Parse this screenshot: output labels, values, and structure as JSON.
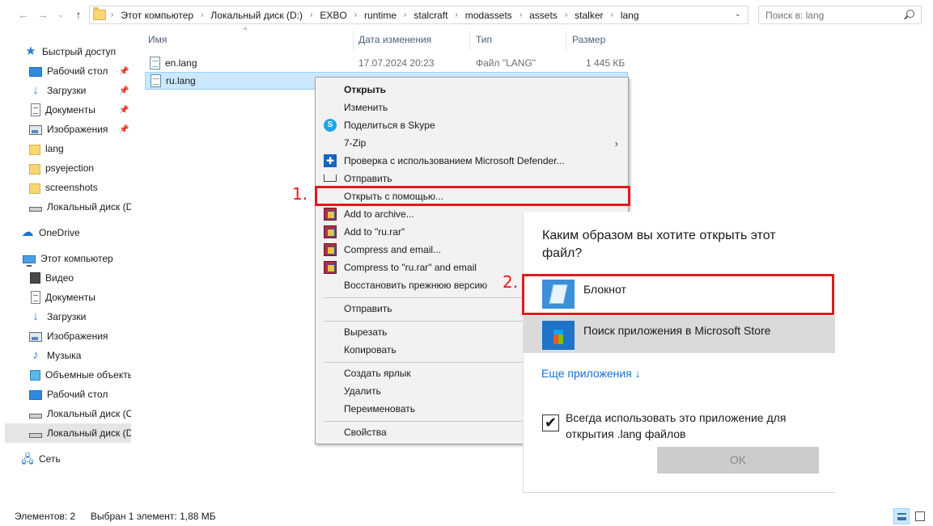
{
  "address": {
    "crumbs": [
      "Этот компьютер",
      "Локальный диск (D:)",
      "EXBO",
      "runtime",
      "stalcraft",
      "modassets",
      "assets",
      "stalker",
      "lang"
    ],
    "search_placeholder": "Поиск в: lang"
  },
  "sidebar": {
    "items": [
      {
        "label": "Быстрый доступ",
        "icon": "star-icon"
      },
      {
        "label": "Рабочий стол",
        "icon": "desktop-icon",
        "pinned": true
      },
      {
        "label": "Загрузки",
        "icon": "downloads-icon",
        "pinned": true
      },
      {
        "label": "Документы",
        "icon": "documents-icon",
        "pinned": true
      },
      {
        "label": "Изображения",
        "icon": "pictures-icon",
        "pinned": true
      },
      {
        "label": "lang",
        "icon": "folder-icon"
      },
      {
        "label": "psyejection",
        "icon": "folder-icon"
      },
      {
        "label": "screenshots",
        "icon": "folder-icon"
      },
      {
        "label": "Локальный диск (D",
        "icon": "drive-icon"
      },
      {
        "label": "OneDrive",
        "icon": "cloud-icon"
      },
      {
        "label": "Этот компьютер",
        "icon": "computer-icon"
      },
      {
        "label": "Видео",
        "icon": "video-icon"
      },
      {
        "label": "Документы",
        "icon": "documents-icon"
      },
      {
        "label": "Загрузки",
        "icon": "downloads-icon"
      },
      {
        "label": "Изображения",
        "icon": "pictures-icon"
      },
      {
        "label": "Музыка",
        "icon": "music-icon"
      },
      {
        "label": "Объемные объекты",
        "icon": "3d-objects-icon"
      },
      {
        "label": "Рабочий стол",
        "icon": "desktop-icon"
      },
      {
        "label": "Локальный диск (C",
        "icon": "drive-icon"
      },
      {
        "label": "Локальный диск (D",
        "icon": "drive-icon",
        "selected": true
      },
      {
        "label": "Сеть",
        "icon": "network-icon"
      }
    ]
  },
  "columns": {
    "name": "Имя",
    "date": "Дата изменения",
    "type": "Тип",
    "size": "Размер"
  },
  "files": [
    {
      "name": "en.lang",
      "date": "17.07.2024 20:23",
      "type": "Файл \"LANG\"",
      "size": "1 445 КБ"
    },
    {
      "name": "ru.lang",
      "selected": true
    }
  ],
  "context_menu": {
    "items": [
      {
        "label": "Открыть",
        "bold": true
      },
      {
        "label": "Изменить"
      },
      {
        "label": "Поделиться в Skype",
        "icon": "skype-icon"
      },
      {
        "label": "7-Zip",
        "submenu": true
      },
      {
        "label": "Проверка с использованием Microsoft Defender...",
        "icon": "defender-icon"
      },
      {
        "label": "Отправить",
        "icon": "share-icon"
      },
      {
        "label": "Открыть с помощью..."
      },
      {
        "label": "Add to archive...",
        "icon": "winrar-icon"
      },
      {
        "label": "Add to \"ru.rar\"",
        "icon": "winrar-icon"
      },
      {
        "label": "Compress and email...",
        "icon": "winrar-icon"
      },
      {
        "label": "Compress to \"ru.rar\" and email",
        "icon": "winrar-icon"
      },
      {
        "label": "Восстановить прежнюю версию"
      },
      {
        "label": "Отправить"
      },
      {
        "label": "Вырезать"
      },
      {
        "label": "Копировать"
      },
      {
        "label": "Создать ярлык"
      },
      {
        "label": "Удалить"
      },
      {
        "label": "Переименовать"
      },
      {
        "label": "Свойства"
      }
    ]
  },
  "open_with": {
    "title": "Каким образом вы хотите открыть этот файл?",
    "apps": [
      {
        "label": "Блокнот",
        "icon": "notepad-icon"
      },
      {
        "label": "Поиск приложения в Microsoft Store",
        "icon": "store-icon"
      }
    ],
    "more_apps": "Еще приложения ↓",
    "always_use": "Всегда использовать это приложение для открытия .lang файлов",
    "always_use_checked": true,
    "ok": "OK"
  },
  "annotations": {
    "step1": "1.",
    "step2": "2.",
    "color": "#e3191e"
  },
  "status": {
    "count": "Элементов: 2",
    "selection": "Выбран 1 элемент: 1,88 МБ"
  }
}
